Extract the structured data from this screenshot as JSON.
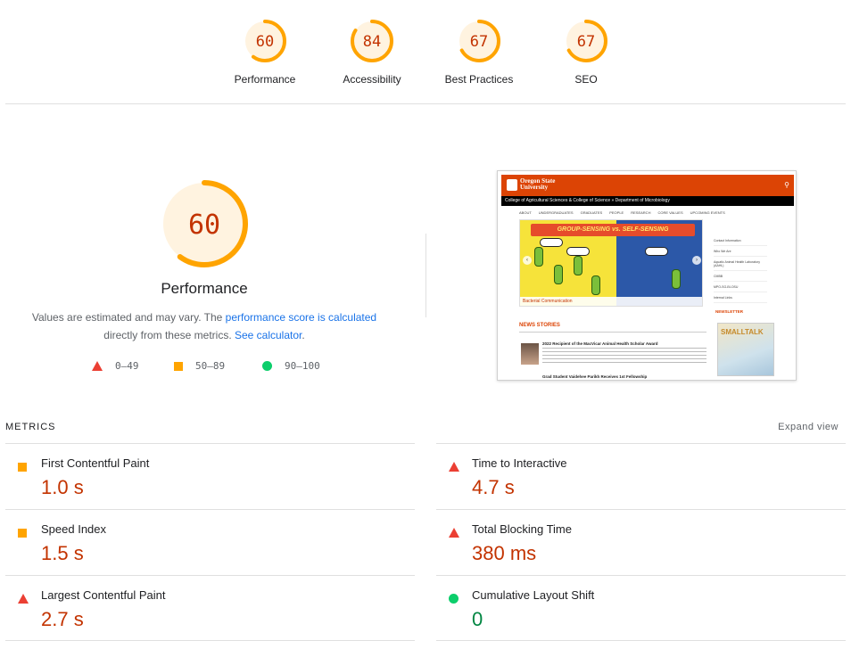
{
  "colors": {
    "fail": "#eb3f33",
    "average": "#ffa400",
    "pass": "#0cce6b",
    "average_text": "#c33300",
    "pass_text": "#018642",
    "link": "#1a73e8"
  },
  "gauges": [
    {
      "label": "Performance",
      "score": "60",
      "fraction": 0.6
    },
    {
      "label": "Accessibility",
      "score": "84",
      "fraction": 0.84
    },
    {
      "label": "Best Practices",
      "score": "67",
      "fraction": 0.67
    },
    {
      "label": "SEO",
      "score": "67",
      "fraction": 0.67
    }
  ],
  "performance": {
    "score": "60",
    "fraction": 0.6,
    "title": "Performance",
    "desc_prefix": "Values are estimated and may vary. The ",
    "desc_link1": "performance score is calculated",
    "desc_middle": " directly from these metrics. ",
    "desc_link2": "See calculator",
    "desc_suffix": "."
  },
  "legend": {
    "fail": "0–49",
    "average": "50–89",
    "pass": "90–100"
  },
  "screenshot": {
    "brand_line1": "Oregon State",
    "brand_line2": "University",
    "subheader": "College of Agricultural Sciences & College of Science » Department of Microbiology",
    "nav": [
      "ABOUT",
      "UNDERGRADUATES",
      "GRADUATES",
      "PEOPLE",
      "RESEARCH",
      "CORE VALUES",
      "UPCOMING EVENTS"
    ],
    "banner_title": "GROUP-SENSING vs. SELF-SENSING",
    "banner_caption": "Bacterial Communication",
    "side_links": [
      "Contact Information",
      "Who We Are",
      "Aquatic Animal Health Laboratory (AAHL)",
      "CMBB",
      "MPO-SG-BI-OSU",
      "Internal Links"
    ],
    "newsletter": "NEWSLETTER",
    "newsletter_title": "SMALLTALK",
    "news_heading": "NEWS STORIES",
    "article_title": "2022 Recipient of the MacVicar Animal Health Scholar Award",
    "article_next": "Grad Student Vaidehee Parikh Receives 1st Fellowship"
  },
  "metrics": {
    "header": "METRICS",
    "expand": "Expand view",
    "items": [
      {
        "name": "First Contentful Paint",
        "value": "1.0 s",
        "rating": "average"
      },
      {
        "name": "Time to Interactive",
        "value": "4.7 s",
        "rating": "fail"
      },
      {
        "name": "Speed Index",
        "value": "1.5 s",
        "rating": "average"
      },
      {
        "name": "Total Blocking Time",
        "value": "380 ms",
        "rating": "fail"
      },
      {
        "name": "Largest Contentful Paint",
        "value": "2.7 s",
        "rating": "fail"
      },
      {
        "name": "Cumulative Layout Shift",
        "value": "0",
        "rating": "pass"
      }
    ]
  }
}
